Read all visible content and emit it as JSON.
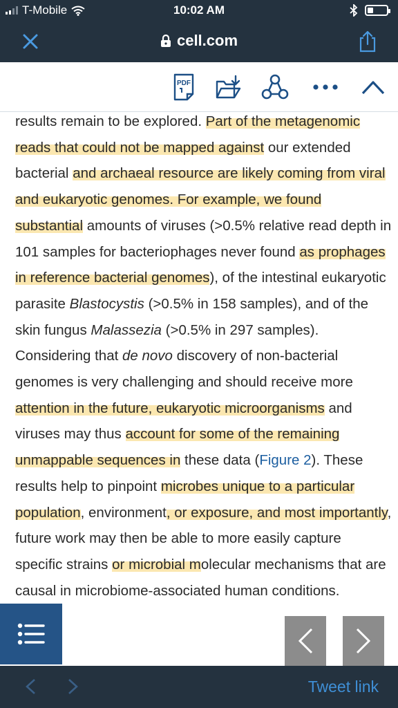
{
  "status_bar": {
    "carrier": "T-Mobile",
    "time": "10:02 AM",
    "battery_level": 0.3
  },
  "browser": {
    "domain": "cell.com"
  },
  "icons": {
    "close": "close-icon",
    "lock": "lock-icon",
    "share": "share-icon",
    "pdf": "pdf-icon",
    "download": "download-folder-icon",
    "network": "network-icon",
    "more": "more-icon",
    "collapse": "chevron-up-icon",
    "outline": "list-icon",
    "prev_page": "chevron-left-icon",
    "next_page": "chevron-right-icon",
    "back": "back-arrow-icon",
    "forward": "forward-arrow-icon"
  },
  "toolbar": {
    "pdf_label": "PDF"
  },
  "article": {
    "t1": "results remain to be explored. ",
    "h1": "Part of the metagenomic reads that could not be mapped against",
    "t2": " our extended bacterial ",
    "h2": "and archaeal resource are likely coming from viral and eukaryotic genomes. For example, we found substantial",
    "t3": " amounts of viruses (>0.5% relative read depth in 101 samples for bacteriophages never found ",
    "h3": "as prophages in reference bacterial genomes",
    "t4": "), of the intestinal eukaryotic parasite ",
    "i1": "Blastocystis",
    "t5": " (>0.5% in 158 samples), and of the skin fungus ",
    "i2": "Malassezia",
    "t6": " (>0.5% in 297 samples). Considering that ",
    "i3": "de novo",
    "t7": " discovery of non-bacterial genomes is very challenging and should receive more ",
    "h4": "attention in the future, eukaryotic microorganisms",
    "t8": " and viruses may thus ",
    "h5": "account for some of the remaining unmappable sequences in",
    "t9": " these data (",
    "link1": "Figure 2",
    "t10": "). These results help to pinpoint ",
    "h6": "microbes unique to a particular population",
    "t11": ", environment",
    "h7": ", or exposure, and most importantly",
    "t12": ", future work may then be able to more easily capture specific strains ",
    "h8": "or microbial m",
    "t13": "olecular mechanisms that are causal in microbiome-associated human conditions."
  },
  "footer": {
    "tweet_link": "Tweet link"
  }
}
